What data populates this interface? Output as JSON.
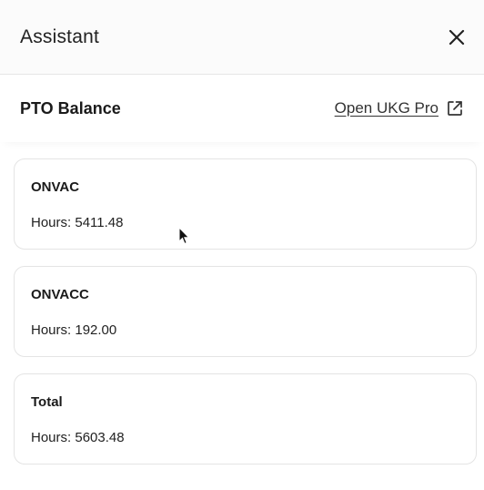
{
  "header": {
    "title": "Assistant",
    "close_icon": "close-icon"
  },
  "section": {
    "heading": "PTO Balance",
    "link_label": "Open UKG Pro",
    "link_icon": "external-link-icon"
  },
  "cards": [
    {
      "name": "ONVAC",
      "hours": "Hours: 5411.48"
    },
    {
      "name": "ONVACC",
      "hours": "Hours: 192.00"
    },
    {
      "name": "Total",
      "hours": "Hours: 5603.48"
    }
  ]
}
